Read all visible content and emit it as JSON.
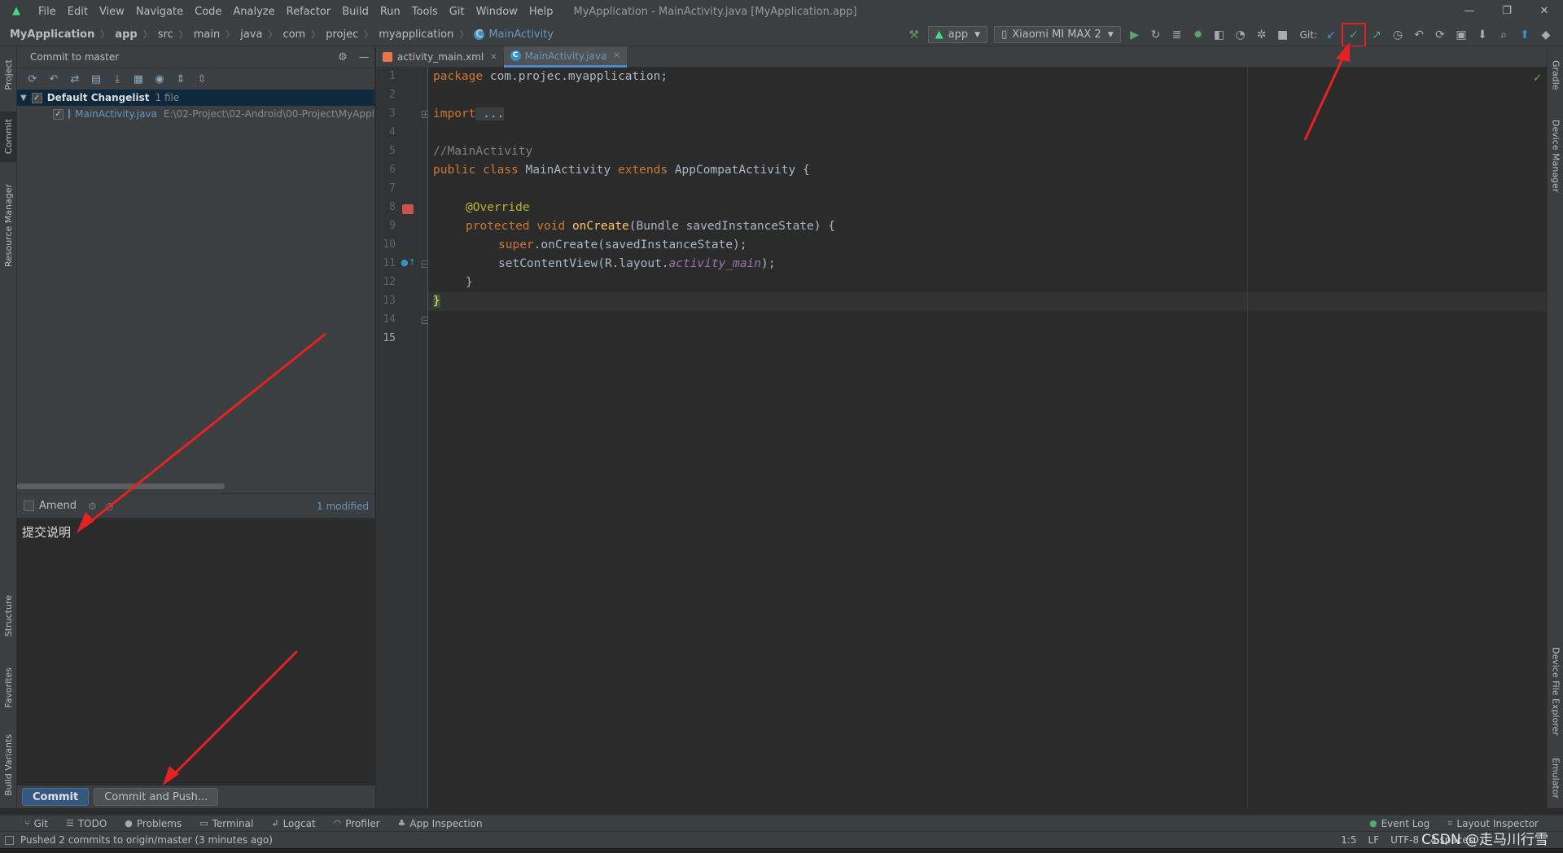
{
  "title_bar": {
    "menu": [
      "File",
      "Edit",
      "View",
      "Navigate",
      "Code",
      "Analyze",
      "Refactor",
      "Build",
      "Run",
      "Tools",
      "Git",
      "Window",
      "Help"
    ],
    "window_title": "MyApplication - MainActivity.java [MyApplication.app]"
  },
  "breadcrumb": [
    "MyApplication",
    "app",
    "src",
    "main",
    "java",
    "com",
    "projec",
    "myapplication",
    "MainActivity"
  ],
  "toolbar": {
    "run_config": "app",
    "device": "Xiaomi MI MAX 2",
    "git_label": "Git:"
  },
  "left_tabs": [
    "Project",
    "Commit",
    "Resource Manager",
    "Structure",
    "Favorites",
    "Build Variants"
  ],
  "right_tabs": [
    "Gradle",
    "Device Manager",
    "Device File Explorer",
    "Emulator"
  ],
  "commit_panel": {
    "title": "Commit to master",
    "changelist": {
      "name": "Default Changelist",
      "count": "1 file"
    },
    "files": [
      {
        "name": "MainActivity.java",
        "path": "E:\\02-Project\\02-Android\\00-Project\\MyAppl"
      }
    ],
    "amend_label": "Amend",
    "modified": "1 modified",
    "message": "提交说明",
    "commit_button": "Commit",
    "commit_push_button": "Commit and Push..."
  },
  "editor": {
    "tabs": [
      "activity_main.xml",
      "MainActivity.java"
    ],
    "active_tab": 1,
    "line_numbers": [
      "1",
      "2",
      "3",
      "4",
      "5",
      "6",
      "7",
      "8",
      "9",
      "10",
      "11",
      "12",
      "13",
      "14",
      "15"
    ]
  },
  "code": {
    "l1_kw": "package",
    "l1_rest": " com.projec.myapplication;",
    "l3_kw": "import",
    "l3_rest": " ...",
    "l7_comment": "//MainActivity",
    "l8_kw1": "public class",
    "l8_name": " MainActivity ",
    "l8_kw2": "extends",
    "l8_rest": " AppCompatActivity {",
    "l10_annot": "@Override",
    "l11_kw": "protected void",
    "l11_fn": " onCreate",
    "l11_rest": "(Bundle savedInstanceState) {",
    "l12_kw": "super",
    "l12_rest": ".onCreate(savedInstanceState);",
    "l13_pre": "setContentView(R.layout.",
    "l13_it": "activity_main",
    "l13_post": ");",
    "l14": "}",
    "l15": "}"
  },
  "bottom_tools": [
    "Git",
    "TODO",
    "Problems",
    "Terminal",
    "Logcat",
    "Profiler",
    "App Inspection"
  ],
  "bottom_right_tools": [
    "Event Log",
    "Layout Inspector"
  ],
  "status": {
    "message": "Pushed 2 commits to origin/master (3 minutes ago)",
    "position": "1:5",
    "line_sep": "LF",
    "encoding": "UTF-8",
    "indent": "4 spaces"
  },
  "watermark": "CSDN @走马川行雪",
  "colors": {
    "accent": "#4a88c7",
    "annotation_arrow": "#e52222",
    "android_green": "#3ddc84"
  }
}
